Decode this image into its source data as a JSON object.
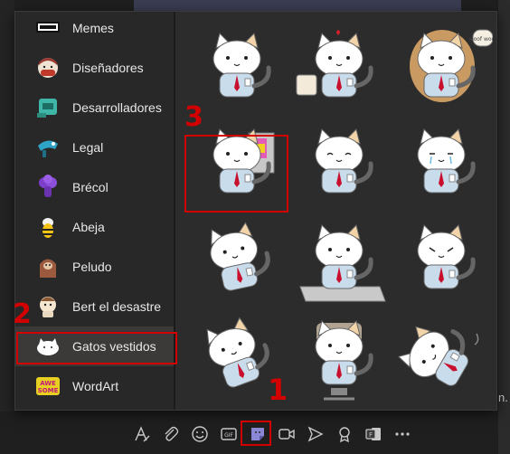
{
  "categories": [
    {
      "label": "Memes",
      "icon": "memes-sticker-icon"
    },
    {
      "label": "Diseñadores",
      "icon": "designer-sticker-icon"
    },
    {
      "label": "Desarrolladores",
      "icon": "developer-sticker-icon"
    },
    {
      "label": "Legal",
      "icon": "legal-sticker-icon"
    },
    {
      "label": "Brécol",
      "icon": "broccoli-sticker-icon"
    },
    {
      "label": "Abeja",
      "icon": "bee-sticker-icon"
    },
    {
      "label": "Peludo",
      "icon": "furry-sticker-icon"
    },
    {
      "label": "Bert el desastre",
      "icon": "bert-sticker-icon"
    },
    {
      "label": "Gatos vestidos",
      "icon": "dressed-cat-sticker-icon"
    },
    {
      "label": "WordArt",
      "icon": "wordart-sticker-icon",
      "text": "AWE SOME"
    }
  ],
  "selected_category": "Gatos vestidos",
  "stickers": [
    "cat-in-shirt-sticker",
    "cat-with-coffee-sticker",
    "cat-in-dog-costume-sticker",
    "cat-at-computer-sticker",
    "cat-laughing-sticker",
    "cat-crying-sticker",
    "cat-jumping-sticker",
    "cat-on-keyboard-sticker",
    "cat-angry-sticker",
    "cat-sliding-sticker",
    "cat-in-office-chair-sticker",
    "cat-fallen-over-sticker"
  ],
  "dog_costume_bubble": "woof woof",
  "annotations": {
    "one": "1",
    "two": "2",
    "three": "3"
  },
  "right_edge_text": "n.",
  "toolbar": [
    "format-icon",
    "attach-icon",
    "emoji-icon",
    "gif-icon",
    "sticker-icon",
    "meet-now-icon",
    "schedule-icon",
    "praise-icon",
    "forms-icon",
    "more-icon"
  ],
  "gif_label": "GIF",
  "colors": {
    "highlight": "#d20000",
    "shirt": "#c9dcec",
    "tie": "#c8102e",
    "selected": "#3b3a39"
  }
}
